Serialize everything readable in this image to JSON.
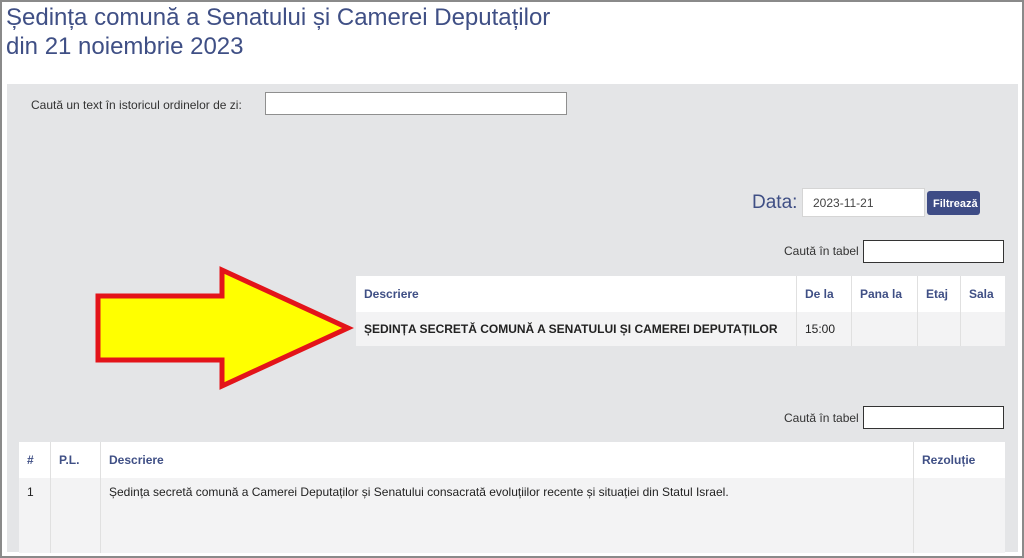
{
  "page": {
    "title_line1": "Ședința comună a Senatului și Camerei Deputaților",
    "title_line2": "din 21 noiembrie 2023"
  },
  "history_search": {
    "label": "Caută un text în istoricul ordinelor de zi:",
    "value": ""
  },
  "filter": {
    "date_label": "Data:",
    "date_value": "2023-11-21",
    "button_label": "Filtrează"
  },
  "agenda_table": {
    "search_label": "Caută în tabel",
    "search_value": "",
    "columns": [
      "Descriere",
      "De la",
      "Pana la",
      "Etaj",
      "Sala"
    ],
    "rows": [
      {
        "descriere": "ȘEDINȚA SECRETĂ COMUNĂ A SENATULUI ȘI CAMEREI DEPUTAȚILOR",
        "de_la": "15:00",
        "pana_la": "",
        "etaj": "",
        "sala": ""
      }
    ]
  },
  "order_table": {
    "search_label": "Caută în tabel",
    "search_value": "",
    "columns": [
      "#",
      "P.L.",
      "Descriere",
      "Rezoluție"
    ],
    "rows": [
      {
        "nr": "1",
        "pl": "",
        "descriere": "Ședința secretă comună a Camerei  Deputaților și Senatului consacrată evoluțiilor recente și situației din Statul Israel.",
        "rezolutie": ""
      }
    ]
  },
  "colors": {
    "accent": "#3f4f85",
    "panel_bg": "#e4e5e7",
    "button_bg": "#3e4c86",
    "arrow_fill": "#ffff00",
    "arrow_stroke": "#e3141a"
  },
  "icons": {
    "annotation": "arrow-right-icon"
  }
}
